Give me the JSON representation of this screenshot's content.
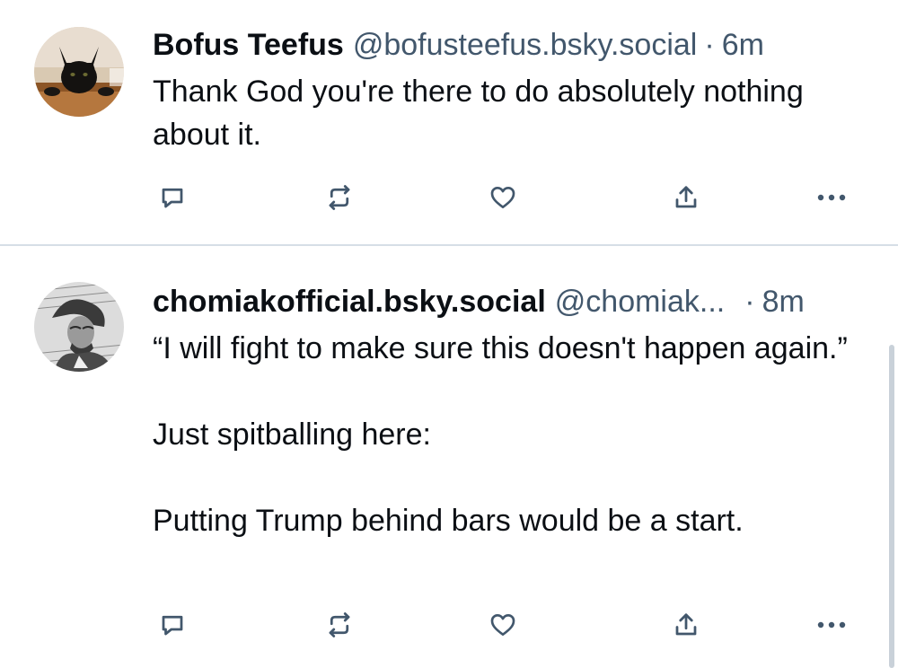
{
  "colors": {
    "text": "#0b0f14",
    "muted": "#42576c",
    "action_icon": "#42576c",
    "divider": "#d6dee6"
  },
  "posts": [
    {
      "author_name": "Bofus Teefus",
      "handle": "@bofusteefus.bsky.social",
      "separator": "·",
      "time": "6m",
      "avatar_icon": "black-cat-avatar",
      "text": [
        "Thank God you're there to do absolutely nothing about it."
      ]
    },
    {
      "author_name": "chomiakofficial.bsky.social",
      "handle": "@chomiak...",
      "separator": "·",
      "time": "8m",
      "avatar_icon": "engraving-portrait-avatar",
      "text": [
        "“I will fight to make sure this doesn't happen again.”",
        "Just spitballing here:",
        "Putting Trump behind bars would be a start."
      ]
    }
  ],
  "actions": [
    "reply-icon",
    "repost-icon",
    "like-icon",
    "share-icon",
    "more-icon"
  ]
}
